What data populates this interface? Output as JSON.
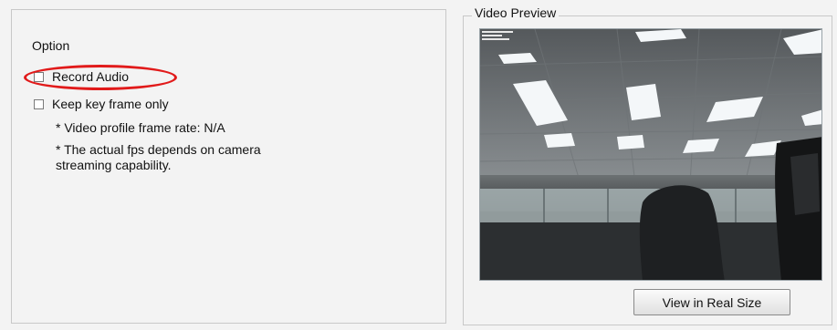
{
  "options": {
    "section_label": "Option",
    "record_audio_label": "Record Audio",
    "record_audio_checked": false,
    "keep_key_frame_label": "Keep key frame only",
    "keep_key_frame_checked": false,
    "note_frame_rate": "* Video profile frame rate: N/A",
    "note_fps": "* The actual fps depends on camera streaming capability."
  },
  "preview": {
    "group_title": "Video Preview",
    "view_real_size_label": "View in Real Size"
  },
  "colors": {
    "highlight": "#e11a1a",
    "panel_bg": "#f3f3f3"
  }
}
